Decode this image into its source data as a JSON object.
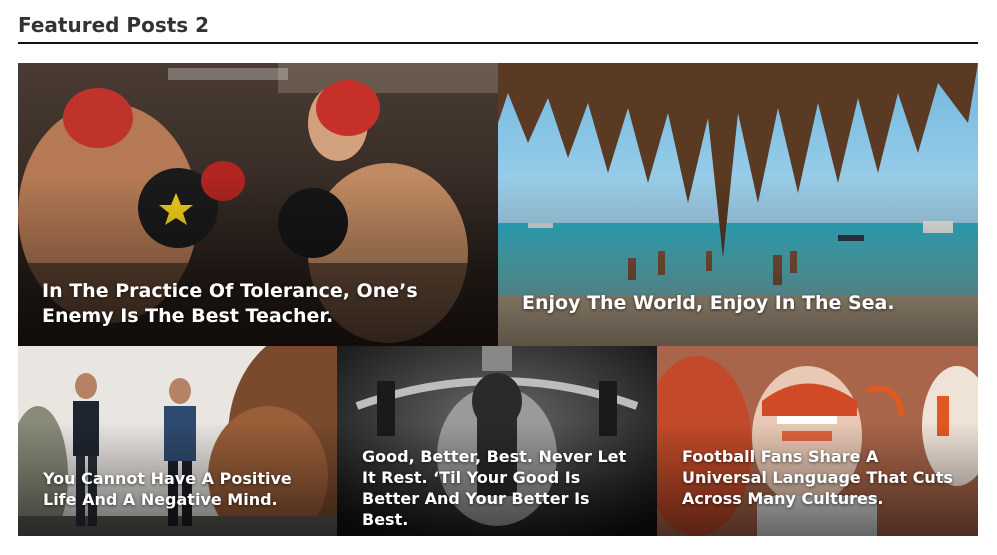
{
  "section": {
    "title": "Featured Posts 2"
  },
  "posts": [
    {
      "title": "In The Practice Of Tolerance, One’s Enemy Is The Best Teacher.",
      "image": "boxing-match-image"
    },
    {
      "title": "Enjoy The World, Enjoy In The Sea.",
      "image": "beach-palm-image"
    },
    {
      "title": "You Cannot Have A Positive Life And A Negative Mind.",
      "image": "runners-image"
    },
    {
      "title": "Good, Better, Best. Never Let It Rest. ‘Til Your Good Is Better And Your Better Is Best.",
      "image": "gym-workout-image"
    },
    {
      "title": "Football Fans Share A Universal Language That Cuts Across Many Cultures.",
      "image": "football-fans-image"
    }
  ]
}
